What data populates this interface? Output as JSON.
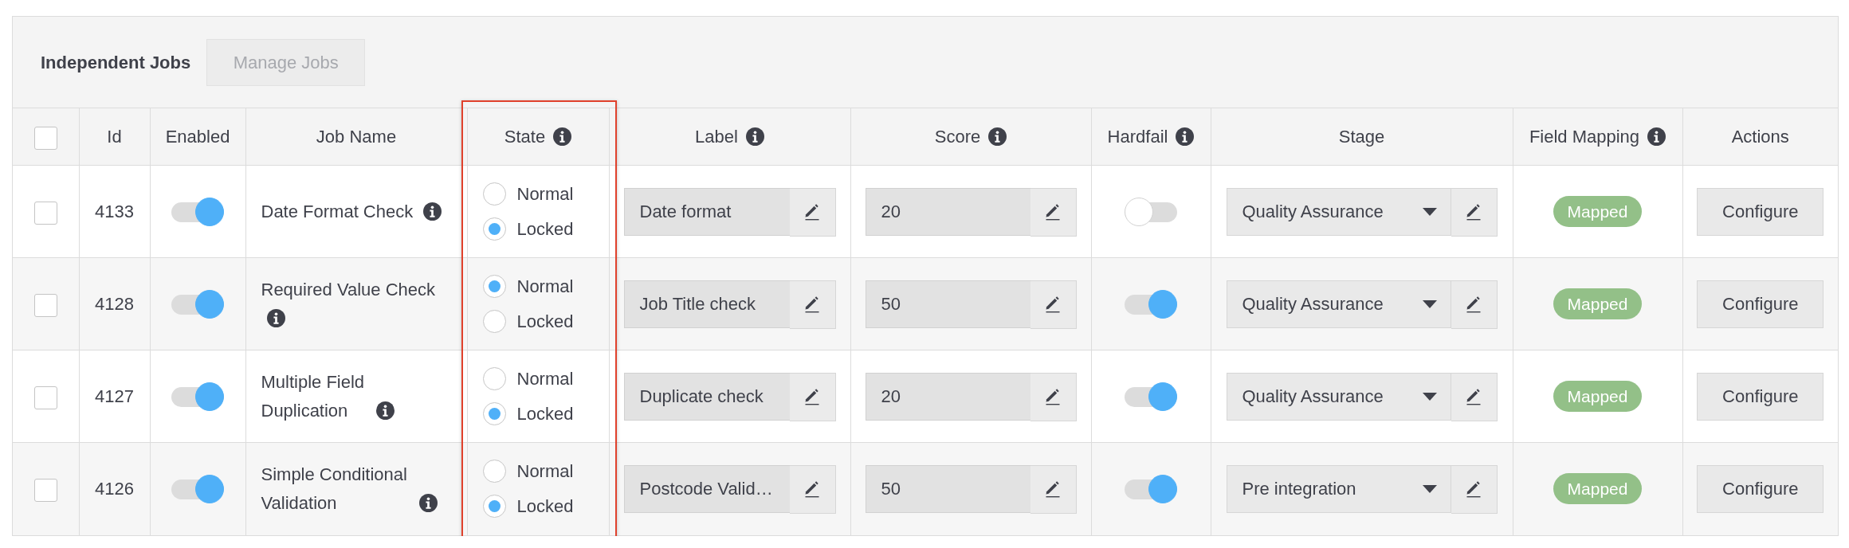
{
  "panel": {
    "title": "Independent Jobs",
    "manage_button": {
      "label": "Manage Jobs",
      "disabled": true
    }
  },
  "table": {
    "select_all": {
      "checked": false
    },
    "columns": [
      {
        "label": "Id",
        "has_info": false,
        "highlighted": false
      },
      {
        "label": "Enabled",
        "has_info": false,
        "highlighted": false
      },
      {
        "label": "Job Name",
        "has_info": false,
        "highlighted": false
      },
      {
        "label": "State",
        "has_info": true,
        "highlighted": true
      },
      {
        "label": "Label",
        "has_info": true,
        "highlighted": false
      },
      {
        "label": "Score",
        "has_info": true,
        "highlighted": false
      },
      {
        "label": "Hardfail",
        "has_info": true,
        "highlighted": false
      },
      {
        "label": "Stage",
        "has_info": false,
        "highlighted": false
      },
      {
        "label": "Field Mapping",
        "has_info": true,
        "highlighted": false
      },
      {
        "label": "Actions",
        "has_info": false,
        "highlighted": false
      }
    ],
    "rows": [
      {
        "checked": false,
        "id": "4133",
        "enabled": true,
        "job_name": "Date Format Check",
        "state_options": [
          {
            "label": "Normal",
            "selected": false
          },
          {
            "label": "Locked",
            "selected": true
          }
        ],
        "label": "Date format",
        "score": "20",
        "hardfail": false,
        "stage": "Quality Assurance",
        "field_mapping": "Mapped",
        "action": "Configure"
      },
      {
        "checked": false,
        "id": "4128",
        "enabled": true,
        "job_name": "Required Value Check",
        "state_options": [
          {
            "label": "Normal",
            "selected": true
          },
          {
            "label": "Locked",
            "selected": false
          }
        ],
        "label": "Job Title check",
        "score": "50",
        "hardfail": true,
        "stage": "Quality Assurance",
        "field_mapping": "Mapped",
        "action": "Configure"
      },
      {
        "checked": false,
        "id": "4127",
        "enabled": true,
        "job_name": "Multiple Field Duplication",
        "state_options": [
          {
            "label": "Normal",
            "selected": false
          },
          {
            "label": "Locked",
            "selected": true
          }
        ],
        "label": "Duplicate check",
        "score": "20",
        "hardfail": true,
        "stage": "Quality Assurance",
        "field_mapping": "Mapped",
        "action": "Configure"
      },
      {
        "checked": false,
        "id": "4126",
        "enabled": true,
        "job_name": "Simple Conditional Validation",
        "state_options": [
          {
            "label": "Normal",
            "selected": false
          },
          {
            "label": "Locked",
            "selected": true
          }
        ],
        "label": "Postcode Valid…",
        "score": "50",
        "hardfail": true,
        "stage": "Pre integration",
        "field_mapping": "Mapped",
        "action": "Configure"
      }
    ]
  }
}
